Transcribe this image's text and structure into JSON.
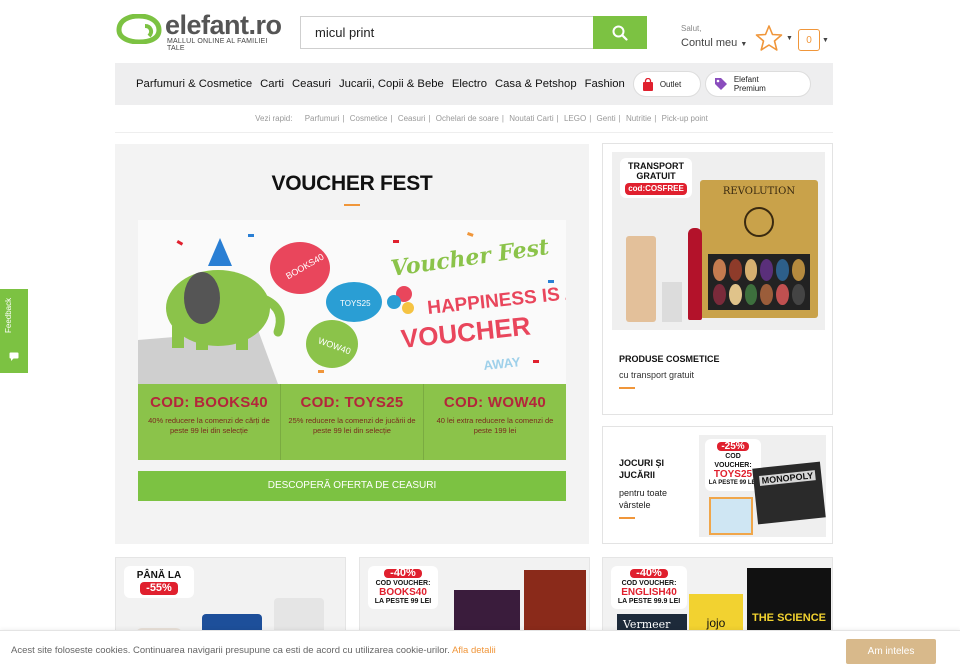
{
  "logo": {
    "name": "elefant.ro",
    "tagline": "MALLUL ONLINE AL FAMILIEI TALE"
  },
  "search": {
    "value": "micul print"
  },
  "account": {
    "greeting": "Salut,",
    "label": "Contul meu"
  },
  "cart": {
    "count": "0"
  },
  "nav": {
    "items": [
      "Parfumuri & Cosmetice",
      "Carti",
      "Ceasuri",
      "Jucarii, Copii & Bebe",
      "Electro",
      "Casa & Petshop",
      "Fashion"
    ],
    "outlet": "Outlet",
    "premium_line1": "Elefant",
    "premium_line2": "Premium"
  },
  "quick_links": {
    "label": "Vezi rapid:",
    "items": [
      "Parfumuri",
      "Cosmetice",
      "Ceasuri",
      "Ochelari de soare",
      "Noutati Carti",
      "LEGO",
      "Genti",
      "Nutritie",
      "Pick-up point"
    ]
  },
  "hero": {
    "title": "VOUCHER FEST",
    "art_title": "Voucher Fest",
    "art_line1": "HAPPINESS IS A",
    "art_line2": "VOUCHER",
    "art_line3": "AWAY",
    "bubble1": "BOOKS40",
    "bubble2": "TOYS25",
    "bubble3": "WOW40",
    "codes": [
      {
        "code": "COD: BOOKS40",
        "desc": "40% reducere la comenzi de cărți de peste 99 lei din selecție"
      },
      {
        "code": "COD: TOYS25",
        "desc": "25% reducere la comenzi de jucării de peste 99 lei din selecție"
      },
      {
        "code": "COD: WOW40",
        "desc": "40 lei extra reducere la comenzi de peste 199 lei"
      }
    ],
    "cta": "DESCOPERĂ OFERTA DE CEASURI"
  },
  "card_cosmetics": {
    "badge_line1": "TRANSPORT",
    "badge_line2": "GRATUIT",
    "badge_code": "cod:COSFREE",
    "palette_brand": "REVOLUTION",
    "title": "PRODUSE COSMETICE",
    "subtitle": "cu transport gratuit"
  },
  "card_toys": {
    "title": "JOCURI ȘI JUCĂRII",
    "subtitle": "pentru toate vârstele",
    "discount": "-25%",
    "voucher_label": "COD VOUCHER:",
    "voucher_code": "TOYS25",
    "voucher_min": "LA PESTE 99 LEI",
    "game_name": "MONOPOLY"
  },
  "bottom": [
    {
      "line1": "PÂNĂ LA",
      "discount": "-55%"
    },
    {
      "discount": "-40%",
      "voucher_label": "COD VOUCHER:",
      "voucher_code": "BOOKS40",
      "voucher_min": "LA PESTE 99 LEI"
    },
    {
      "discount": "-40%",
      "voucher_label": "COD VOUCHER:",
      "voucher_code": "ENGLISH40",
      "voucher_min": "LA PESTE 99.9 LEI",
      "book1": "Vermeer",
      "book2": "jojo",
      "book3": "THE SCIENCE"
    }
  ],
  "feedback": {
    "label": "Feedback"
  },
  "cookie": {
    "message": "Acest site foloseste cookies. Continuarea navigarii presupune ca esti de acord cu utilizarea cookie-urilor.",
    "more": "Afla detalii",
    "accept": "Am inteles"
  },
  "colors": {
    "brand_green": "#7cc242",
    "accent_orange": "#f0963a",
    "red": "#e0202e"
  }
}
